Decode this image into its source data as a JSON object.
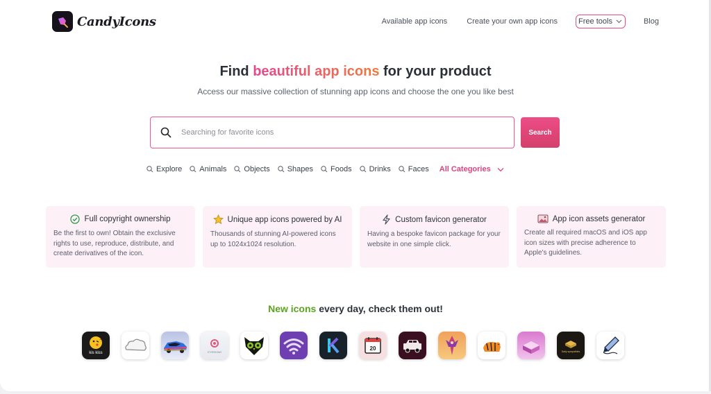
{
  "brand": {
    "name": "CandyIcons",
    "icon": "candy-logo-icon"
  },
  "nav": {
    "items": [
      "Available app icons",
      "Create your own app icons"
    ],
    "tools_label": "Free tools",
    "blog_label": "Blog"
  },
  "hero": {
    "title_prefix": "Find ",
    "title_highlight": "beautiful app icons",
    "title_suffix": " for your product",
    "subtitle": "Access our massive collection of stunning app icons and choose the one you like best"
  },
  "search": {
    "placeholder": "Searching for favorite icons",
    "value": "",
    "button_label": "Search"
  },
  "categories": {
    "items": [
      "Explore",
      "Animals",
      "Objects",
      "Shapes",
      "Foods",
      "Drinks",
      "Faces"
    ],
    "all_label": "All Categories"
  },
  "features": [
    {
      "icon": "check-circle-icon",
      "title": "Full copyright ownership",
      "body": "Be the first to own! Obtain the exclusive rights to use, reproduce, distribute, and create derivatives of the icon."
    },
    {
      "icon": "star-icon",
      "title": "Unique app icons powered by AI",
      "body": "Thousands of stunning AI-powered icons up to 1024x1024 resolution."
    },
    {
      "icon": "lightning-icon",
      "title": "Custom favicon generator",
      "body": "Having a bespoke favicon package for your website in one simple click."
    },
    {
      "icon": "image-icon",
      "title": "App icon assets generator",
      "body": "Create all required macOS and iOS app icon sizes with precise adherence to Apple's guidelines."
    }
  ],
  "new_icons": {
    "title_highlight": "New icons",
    "title_rest": " every day, check them out!",
    "icons": [
      {
        "name": "kiss-face-app-icon",
        "label": "kis kiss"
      },
      {
        "name": "cloud-app-icon"
      },
      {
        "name": "race-car-app-icon"
      },
      {
        "name": "circle-logo-app-icon",
        "label": "EYREKIWI"
      },
      {
        "name": "owl-app-icon"
      },
      {
        "name": "wifi-app-icon"
      },
      {
        "name": "letter-k-app-icon"
      },
      {
        "name": "calendar-app-icon",
        "label": "20"
      },
      {
        "name": "jeep-app-icon"
      },
      {
        "name": "ornament-app-icon"
      },
      {
        "name": "tiger-app-icon"
      },
      {
        "name": "pink-box-app-icon"
      },
      {
        "name": "tray-app-icon",
        "label": "Daily sympathies"
      },
      {
        "name": "pencil-app-icon"
      }
    ]
  },
  "colors": {
    "accent": "#e8589a",
    "button": "#dc4579",
    "green": "#5aa51f",
    "card_bg": "#fdf0f6"
  }
}
